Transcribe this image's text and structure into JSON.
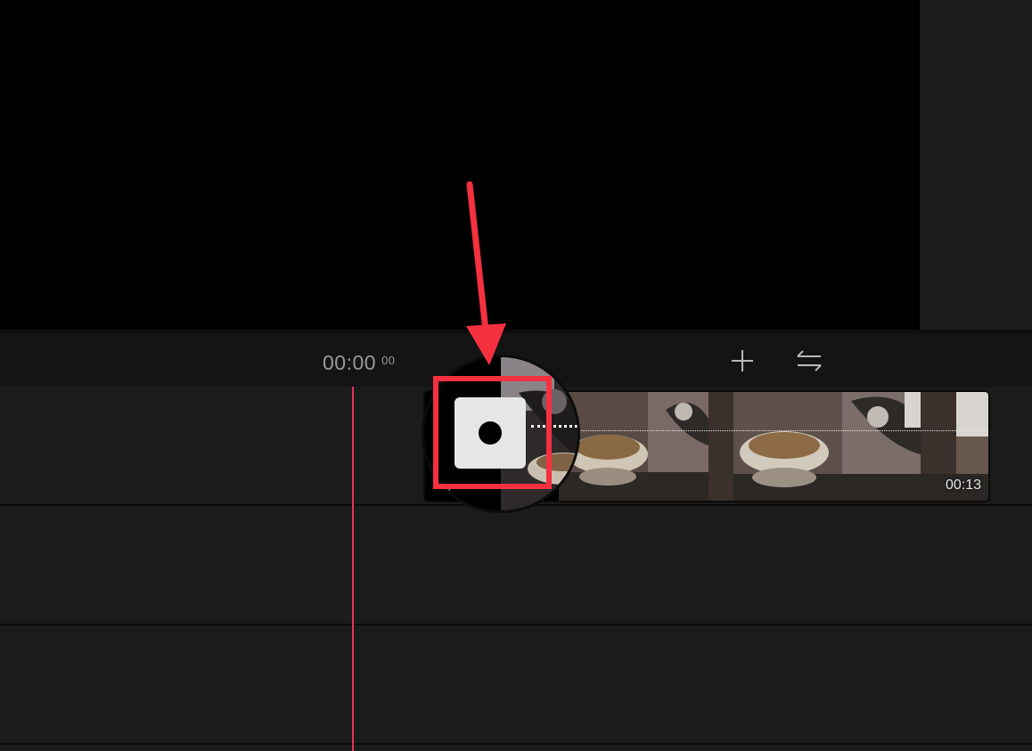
{
  "toolbar": {
    "timecode_main": "00:00",
    "timecode_frames": "00",
    "add_icon": "plus-icon",
    "swap_icon": "swap-arrows-icon"
  },
  "clip": {
    "duration": "00:13",
    "start_label": "0"
  },
  "keyframe": {
    "icon": "keyframe-dot-icon"
  },
  "annotation": {
    "color": "#f5303f"
  },
  "colors": {
    "playhead": "#e8325a",
    "background": "#1b1b1b"
  }
}
